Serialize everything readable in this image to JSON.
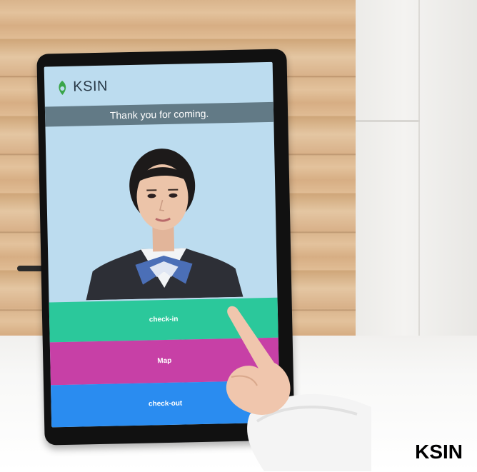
{
  "screen": {
    "brand_name": "KSIN",
    "greeting": "Thank you for coming.",
    "buttons": {
      "checkin": "check-in",
      "map": "Map",
      "checkout": "check-out"
    }
  },
  "watermark": "KSIN",
  "colors": {
    "checkin": "#2bc89b",
    "map": "#c740a6",
    "checkout": "#2a8cf0",
    "title_bar": "#627a86",
    "screen_bg": "#bcdcef"
  }
}
